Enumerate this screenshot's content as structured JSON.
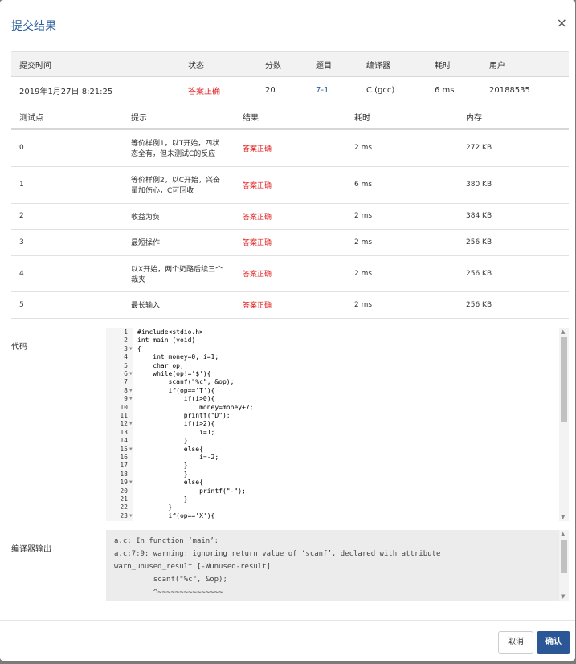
{
  "dialog": {
    "title": "提交结果",
    "close": "×",
    "cancel_label": "取消",
    "ok_label": "确认"
  },
  "summary": {
    "headers": [
      "提交时间",
      "状态",
      "分数",
      "题目",
      "编译器",
      "耗时",
      "用户"
    ],
    "row": {
      "time": "2019年1月27日 8:21:25",
      "status": "答案正确",
      "score": "20",
      "problem": "7-1",
      "compiler": "C (gcc)",
      "duration": "6 ms",
      "user": "20188535"
    }
  },
  "tests": {
    "headers": [
      "测试点",
      "提示",
      "结果",
      "耗时",
      "内存"
    ],
    "rows": [
      {
        "id": "0",
        "hint": "等价样例1，以T开始，四状态全有，但未测试C的反应",
        "result": "答案正确",
        "time": "2 ms",
        "mem": "272 KB"
      },
      {
        "id": "1",
        "hint": "等价样例2，以C开始，兴奋量加伤心，C可回收",
        "result": "答案正确",
        "time": "6 ms",
        "mem": "380 KB"
      },
      {
        "id": "2",
        "hint": "收益为负",
        "result": "答案正确",
        "time": "2 ms",
        "mem": "384 KB"
      },
      {
        "id": "3",
        "hint": "最短操作",
        "result": "答案正确",
        "time": "2 ms",
        "mem": "256 KB"
      },
      {
        "id": "4",
        "hint": "以X开始，两个奶酪后续三个裁夹",
        "result": "答案正确",
        "time": "2 ms",
        "mem": "256 KB"
      },
      {
        "id": "5",
        "hint": "最长输入",
        "result": "答案正确",
        "time": "2 ms",
        "mem": "256 KB"
      }
    ]
  },
  "code_label": "代码",
  "code_lines": [
    "#include<stdio.h>",
    "int main (void)",
    "{",
    "    int money=0, i=1;",
    "    char op;",
    "    while(op!='$'){",
    "        scanf(\"%c\", &op);",
    "        if(op=='T'){",
    "            if(i>0){",
    "                money=money+7;",
    "            printf(\"D\");",
    "            if(i>2){",
    "                i=1;",
    "            }",
    "            else{",
    "                i=-2;",
    "            }",
    "            }",
    "            else{",
    "                printf(\"-\");",
    "            }",
    "        }",
    "        if(op=='X'){"
  ],
  "compiler_label": "编译器输出",
  "compiler_output": "a.c: In function ‘main’:\na.c:7:9: warning: ignoring return value of ‘scanf’, declared with attribute\nwarn_unused_result [-Wunused-result]\n         scanf(\"%c\", &op);\n         ^~~~~~~~~~~~~~~~"
}
